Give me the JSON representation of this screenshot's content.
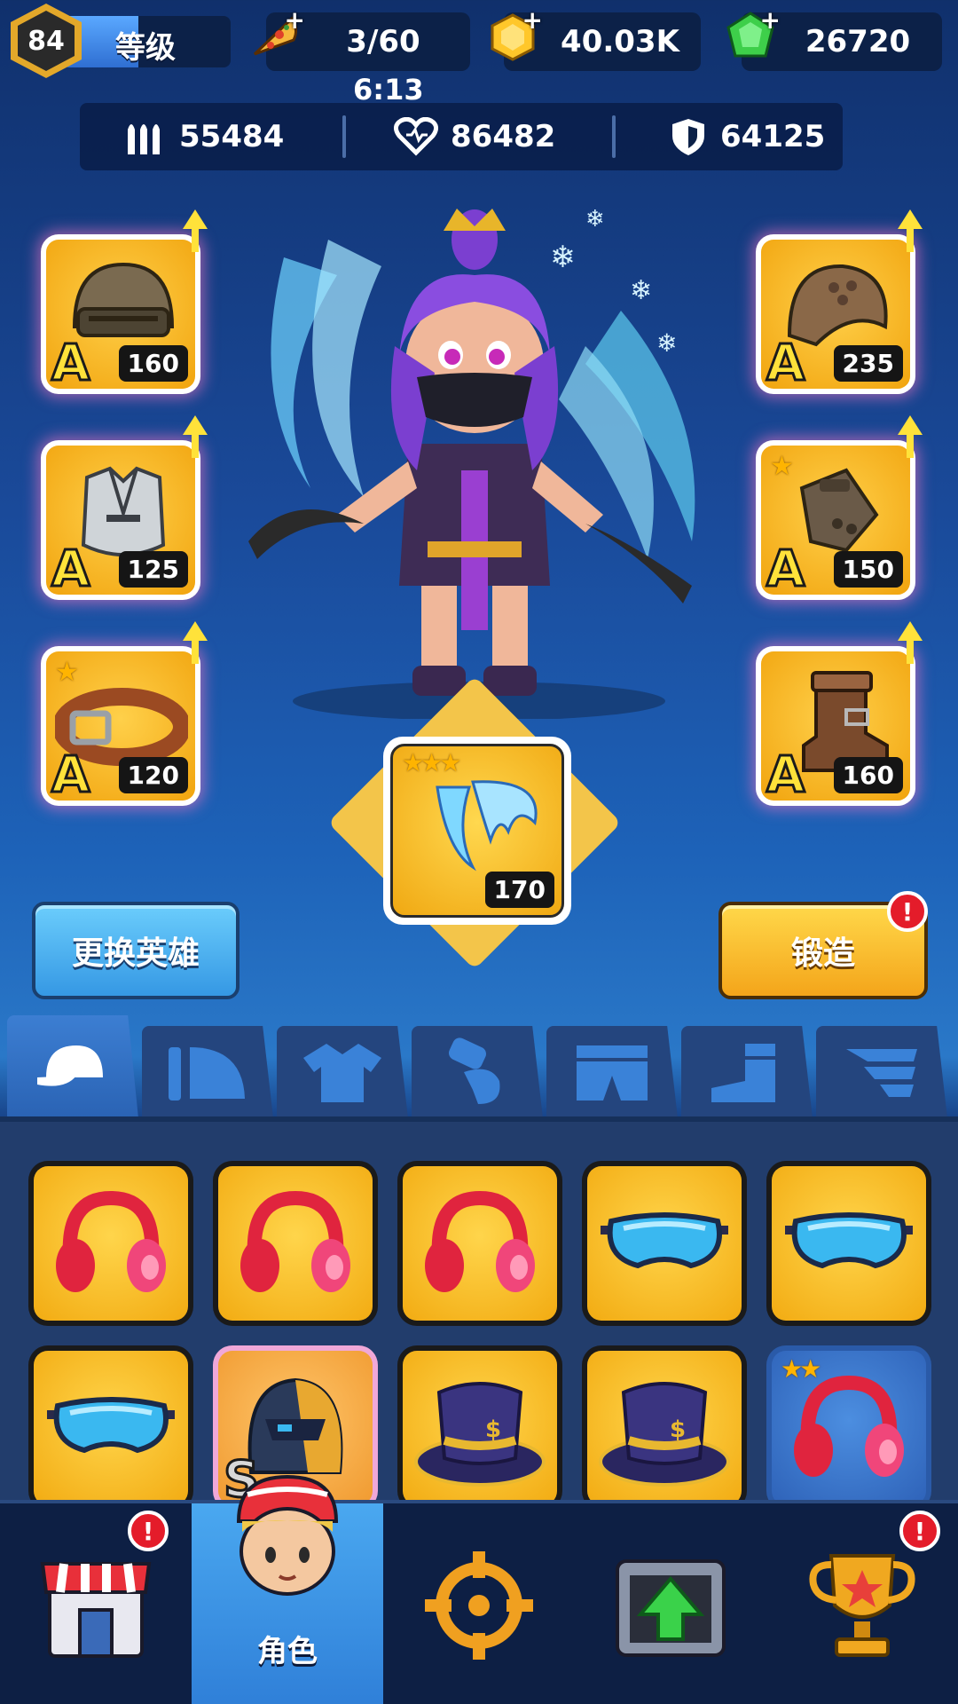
{
  "top_bar": {
    "level": "84",
    "level_label": "等级",
    "level_progress": 0.45,
    "energy": "3/60",
    "energy_timer": "6:13",
    "gold": "40.03K",
    "gems": "26720"
  },
  "stats": {
    "attack": "55484",
    "health": "86482",
    "defense": "64125"
  },
  "equipment": {
    "left": [
      {
        "name": "helmet",
        "grade": "A",
        "power": "160"
      },
      {
        "name": "chest-armor",
        "grade": "A",
        "power": "125"
      },
      {
        "name": "belt",
        "grade": "A",
        "power": "120"
      }
    ],
    "right": [
      {
        "name": "shoulder",
        "grade": "A",
        "power": "235"
      },
      {
        "name": "gauntlet",
        "grade": "A",
        "power": "150"
      },
      {
        "name": "boots",
        "grade": "A",
        "power": "160"
      }
    ],
    "wings": {
      "power": "170",
      "stars": 3
    }
  },
  "buttons": {
    "change_hero": "更换英雄",
    "forge": "锻造",
    "badge": "!"
  },
  "inventory_tabs": [
    "cap",
    "shoulder",
    "shirt",
    "glove",
    "pants",
    "boots",
    "wings"
  ],
  "inventory": [
    {
      "item": "headphones"
    },
    {
      "item": "headphones"
    },
    {
      "item": "headphones"
    },
    {
      "item": "goggles"
    },
    {
      "item": "goggles"
    },
    {
      "item": "goggles"
    },
    {
      "item": "robot-helmet",
      "grade": "S"
    },
    {
      "item": "top-hat"
    },
    {
      "item": "top-hat"
    },
    {
      "item": "headphones",
      "stars": 2
    }
  ],
  "nav": {
    "shop": "shop",
    "character": "角色",
    "battle": "battle",
    "upgrade": "upgrade",
    "trophy": "trophy"
  },
  "colors": {
    "accent_yellow": "#ffd84a",
    "accent_blue": "#4aa8f0",
    "badge_red": "#e41c2a"
  }
}
